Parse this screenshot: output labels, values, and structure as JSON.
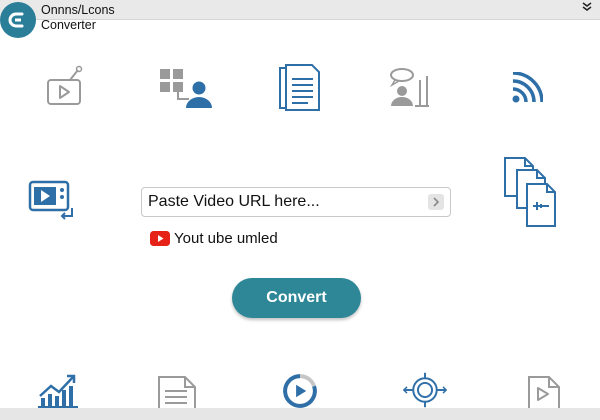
{
  "app": {
    "title_line1": "Onnns/Lcons",
    "title_line2": "Converter",
    "logo_icon": "converter-logo-icon"
  },
  "url_input": {
    "placeholder": "Paste Video URL here...",
    "value": ""
  },
  "source": {
    "icon": "youtube-icon",
    "label": "Yout ube umled"
  },
  "convert_button": {
    "label": "Convert"
  },
  "icons": {
    "top_row": [
      "tv-play-icon",
      "network-user-icon",
      "document-icon",
      "chat-user-icon",
      "wifi-signal-icon"
    ],
    "middle": [
      "video-player-icon",
      "file-convert-icon"
    ],
    "bottom_row": [
      "bar-chart-icon",
      "document-icon",
      "play-progress-icon",
      "target-icon",
      "video-file-icon"
    ]
  },
  "colors": {
    "accent": "#2e8796",
    "icon_blue": "#2f6fa8",
    "icon_gray": "#9a9a9a",
    "youtube_red": "#e62117"
  }
}
